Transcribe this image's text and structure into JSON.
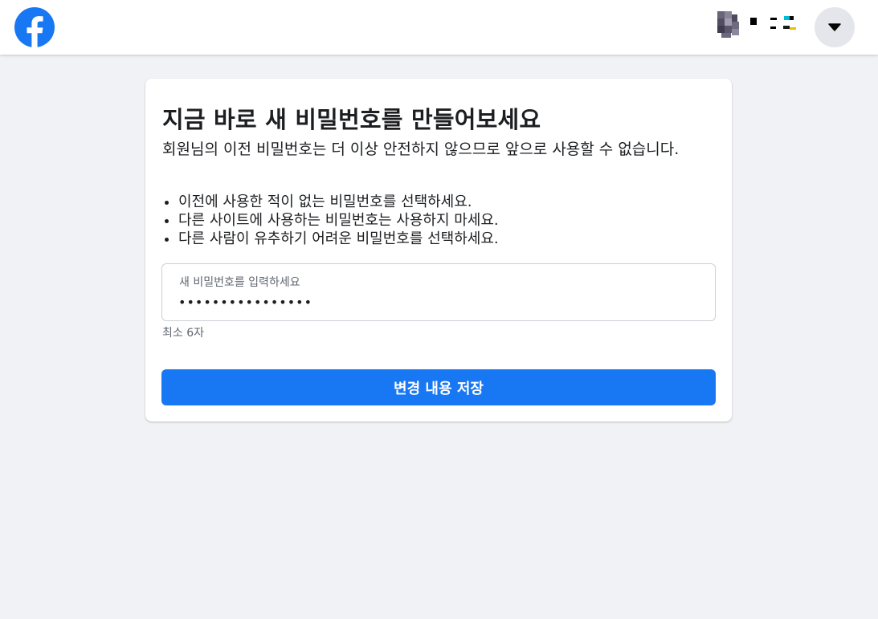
{
  "header": {
    "logo_icon": "facebook-logo-icon",
    "account_name": "",
    "account_icon": "profile-avatar-icon",
    "menu_icon": "caret-down-icon"
  },
  "colors": {
    "brand": "#1877f2",
    "background": "#f0f2f5",
    "text": "#1c1e21",
    "secondary_text": "#606770"
  },
  "card": {
    "title": "지금 바로 새 비밀번호를 만들어보세요",
    "description": "회원님의 이전 비밀번호는 더 이상 안전하지 않으므로 앞으로 사용할 수 없습니다.",
    "tips": [
      "이전에 사용한 적이 없는 비밀번호를 선택하세요.",
      "다른 사이트에 사용하는 비밀번호는 사용하지 마세요.",
      "다른 사람이 유추하기 어려운 비밀번호를 선택하세요."
    ],
    "password_field": {
      "label": "새 비밀번호를 입력하세요",
      "value": "................"
    },
    "hint": "최소 6자",
    "save_button_label": "변경 내용 저장"
  }
}
